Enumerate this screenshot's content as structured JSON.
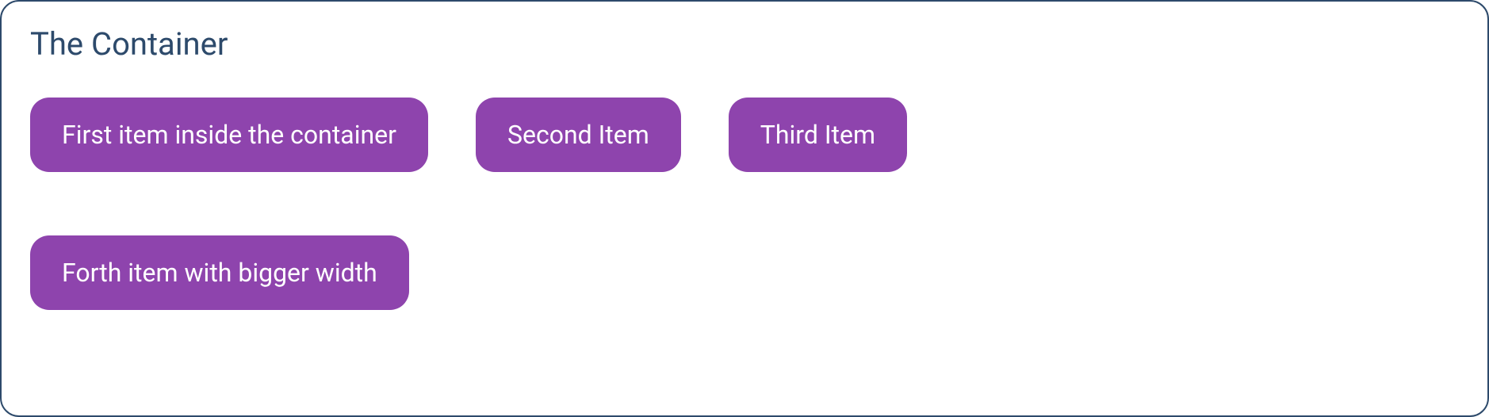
{
  "container": {
    "title": "The Container",
    "items": [
      {
        "label": "First item inside the container"
      },
      {
        "label": "Second Item"
      },
      {
        "label": "Third Item"
      },
      {
        "label": "Forth item with bigger width"
      }
    ]
  },
  "colors": {
    "border": "#2d4a6b",
    "title": "#2d4a6b",
    "item_bg": "#8e44ad",
    "item_text": "#ffffff"
  }
}
